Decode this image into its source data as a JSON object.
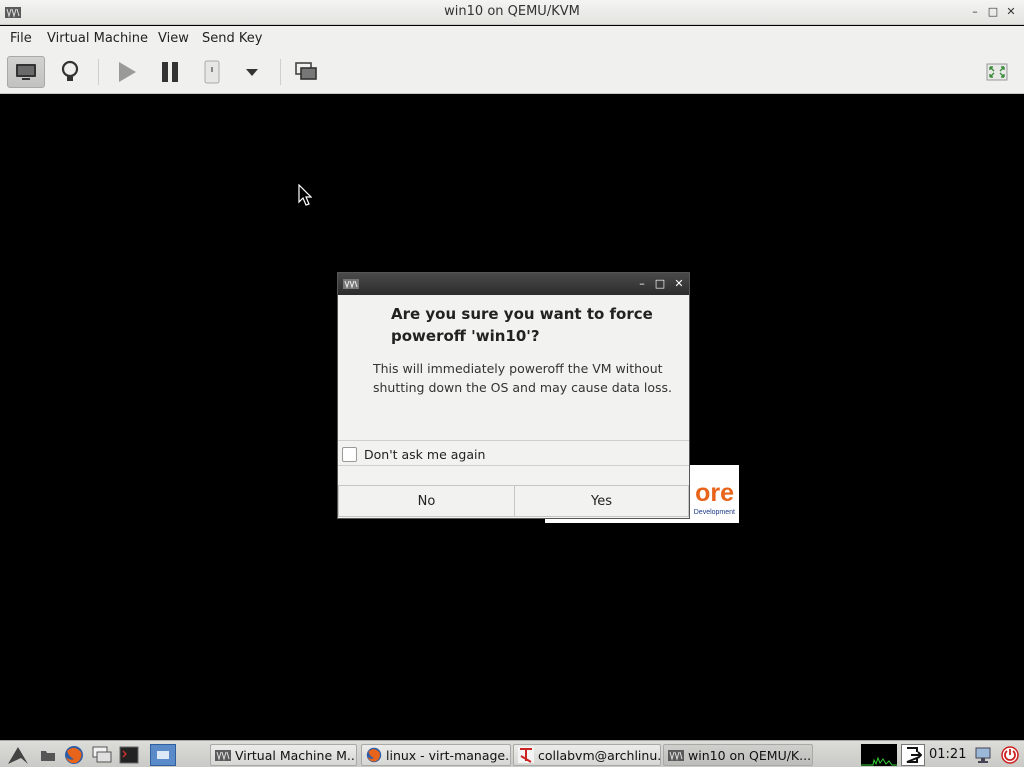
{
  "window": {
    "title": "win10 on QEMU/KVM"
  },
  "menu": {
    "items": [
      "File",
      "Virtual Machine",
      "View",
      "Send Key"
    ]
  },
  "dialog": {
    "heading": "Are you sure you want to force poweroff 'win10'?",
    "body": "This will immediately poweroff the VM without shutting down the OS and may cause data loss.",
    "checkbox_label": "Don't ask me again",
    "checkbox_checked": false,
    "no_label": "No",
    "yes_label": "Yes"
  },
  "background_logo": {
    "text": "ore",
    "subtext": "Development"
  },
  "taskbar": {
    "tasks": [
      {
        "label": "Virtual Machine M...",
        "icon": "virt-manager-icon"
      },
      {
        "label": "linux - virt-manage...",
        "icon": "firefox-icon"
      },
      {
        "label": "collabvm@archlinu...",
        "icon": "terminal-icon"
      },
      {
        "label": "win10 on QEMU/K...",
        "icon": "virt-manager-icon"
      }
    ],
    "clock": "01:21"
  },
  "colors": {
    "accent_orange": "#e8641a",
    "dialog_titlebar": "#2c2c2c",
    "vm_display": "#000000"
  }
}
